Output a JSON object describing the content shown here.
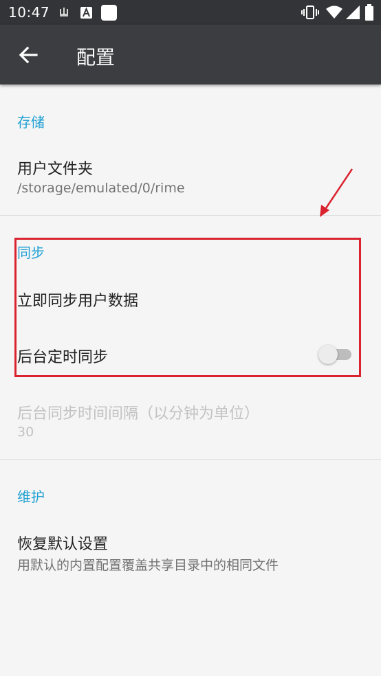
{
  "status_bar": {
    "time": "10:47",
    "left_icons": [
      "usb-debug-icon",
      "font-a-icon",
      "app-square-icon"
    ],
    "right_icons": [
      "vibrate-icon",
      "wifi-icon",
      "signal-icon",
      "battery-icon"
    ]
  },
  "app_bar": {
    "back_icon": "arrow-left-icon",
    "title": "配置"
  },
  "sections": {
    "storage": {
      "title": "存储",
      "user_folder": {
        "title": "用户文件夹",
        "summary": "/storage/emulated/0/rime"
      }
    },
    "sync": {
      "title": "同步",
      "sync_now": {
        "title": "立即同步用户数据"
      },
      "background_sync": {
        "title": "后台定时同步",
        "enabled": false
      },
      "sync_interval": {
        "title": "后台同步时间间隔（以分钟为单位）",
        "summary": "30"
      }
    },
    "maintenance": {
      "title": "维护",
      "restore_defaults": {
        "title": "恢复默认设置",
        "summary": "用默认的内置配置覆盖共享目录中的相同文件"
      }
    }
  },
  "colors": {
    "accent": "#1e9fd3",
    "annotation_red": "#d9232e",
    "app_bar": "#3c3d40",
    "status_bar": "#333437"
  }
}
